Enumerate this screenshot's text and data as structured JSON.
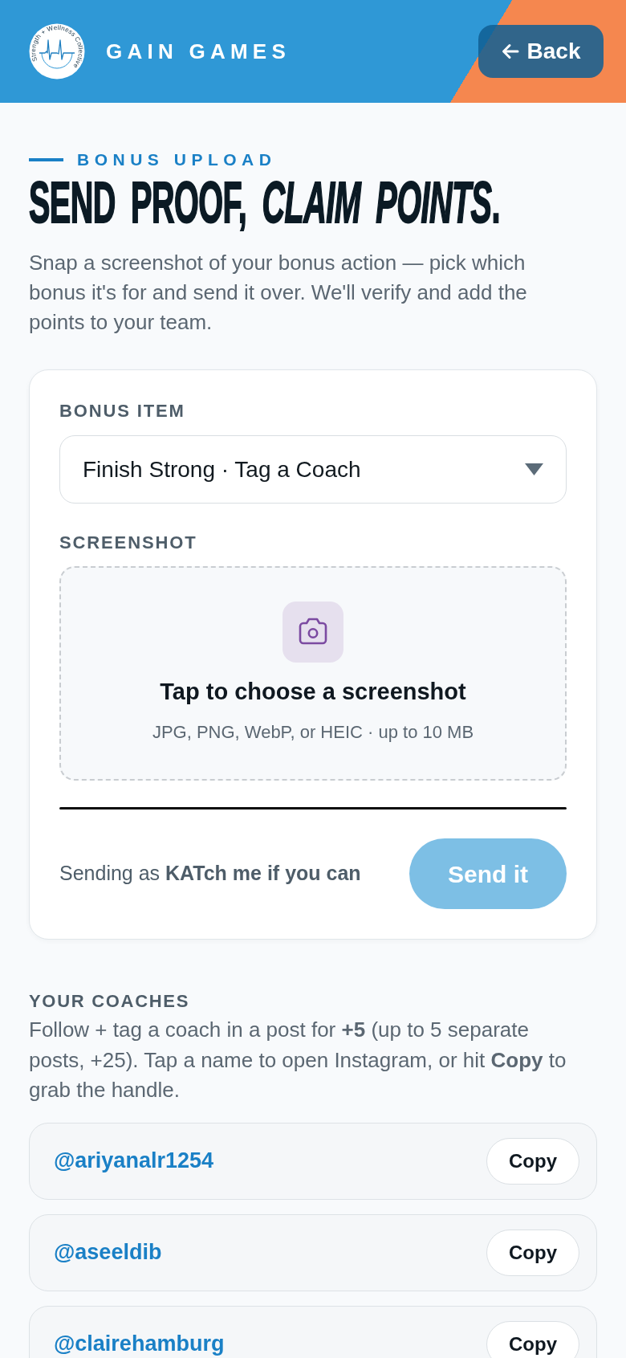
{
  "header": {
    "logo_text": "Strength + Wellness Collective",
    "brand": "GAIN GAMES",
    "back_button": "Back"
  },
  "intro": {
    "eyebrow": "BONUS UPLOAD",
    "headline": "SEND PROOF, *CLAIM POINTS*.",
    "description": "Snap a screenshot of your bonus action — pick which bonus it's for and send it over. We'll verify and add the points to your team."
  },
  "form": {
    "bonus_label": "BONUS ITEM",
    "bonus_value": "Finish Strong · Tag a Coach",
    "screenshot_label": "SCREENSHOT",
    "upload_title": "Tap to choose a screenshot",
    "upload_hint": "JPG, PNG, WebP, or HEIC · up to 10 MB",
    "sender": "Sending as **KATch me if you can**",
    "submit": {
      "label": "Send it",
      "disabled": true
    }
  },
  "coaches": {
    "title": "YOUR COACHES",
    "description": "Follow + tag a coach in a post for **+5** (up to 5 separate posts, +25). Tap a name to open Instagram, or hit **Copy** to grab the handle.",
    "items": [
      {
        "handle": "@ariyanalr1254",
        "action": "Copy"
      },
      {
        "handle": "@aseeldib",
        "action": "Copy"
      },
      {
        "handle": "@clairehamburg",
        "action": "Copy"
      }
    ]
  }
}
